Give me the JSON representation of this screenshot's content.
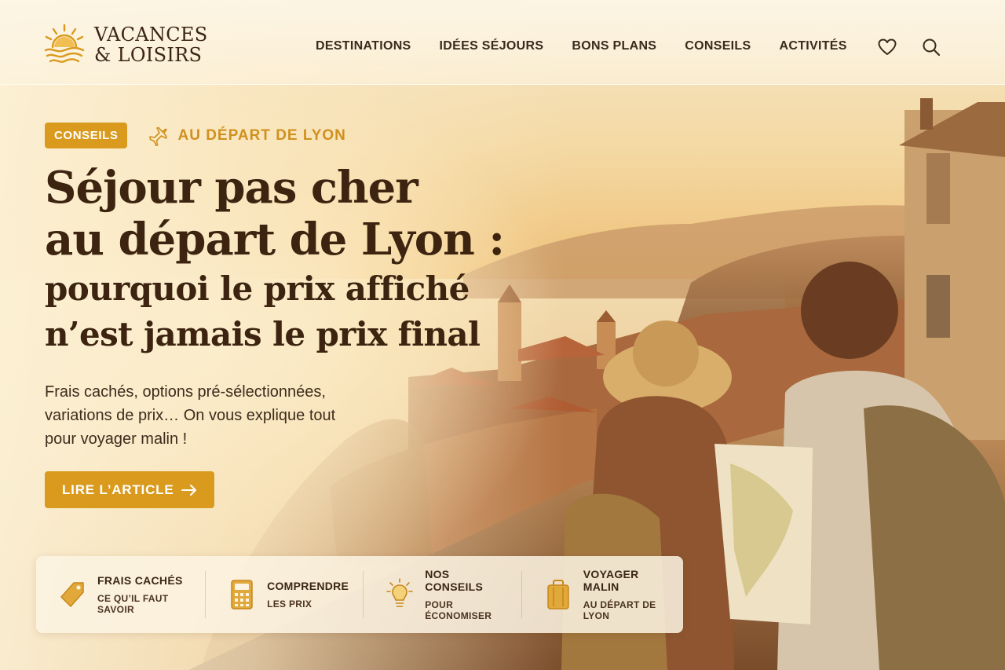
{
  "brand": {
    "line1": "VACANCES",
    "line2": "& LOISIRS"
  },
  "nav": {
    "items": [
      {
        "label": "DESTINATIONS"
      },
      {
        "label": "IDÉES SÉJOURS"
      },
      {
        "label": "BONS PLANS"
      },
      {
        "label": "CONSEILS"
      },
      {
        "label": "ACTIVITÉS"
      }
    ],
    "icons": [
      "heart-icon",
      "search-icon"
    ]
  },
  "hero": {
    "badge": "CONSEILS",
    "departure": "AU DÉPART DE LYON",
    "title_line1": "Séjour pas cher",
    "title_line2": "au départ de Lyon :",
    "title_line3": "pourquoi le prix affiché",
    "title_line4": "n’est jamais le prix final",
    "lede": "Frais cachés, options pré-sélectionnées, variations de prix… On vous explique tout pour voyager malin !",
    "cta": "LIRE L’ARTICLE"
  },
  "features": [
    {
      "title": "FRAIS CACHÉS",
      "subtitle": "CE QU’IL FAUT SAVOIR",
      "icon": "price-tag-icon"
    },
    {
      "title": "COMPRENDRE",
      "subtitle": "LES PRIX",
      "icon": "calculator-icon"
    },
    {
      "title": "NOS CONSEILS",
      "subtitle": "POUR ÉCONOMISER",
      "icon": "lightbulb-icon"
    },
    {
      "title": "VOYAGER MALIN",
      "subtitle": "AU DÉPART DE LYON",
      "icon": "suitcase-icon"
    }
  ],
  "colors": {
    "accent": "#d99a1e",
    "text_dark": "#3c2410",
    "strip_bg": "#fcf3e2"
  }
}
